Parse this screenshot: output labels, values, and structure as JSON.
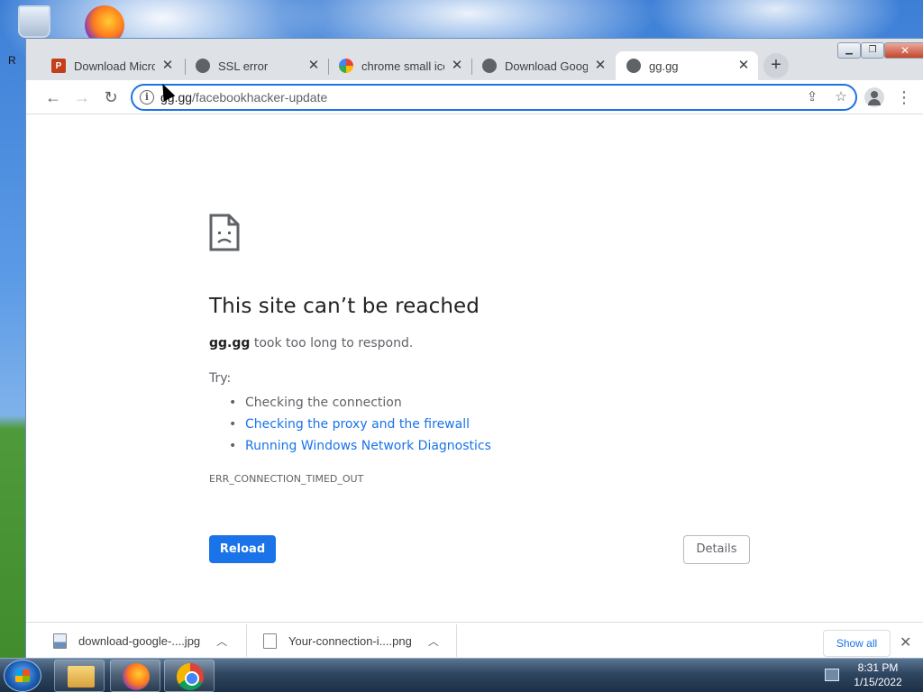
{
  "tabs": [
    {
      "title": "Download Microsoft",
      "favicon": "powerpoint-icon"
    },
    {
      "title": "SSL error",
      "favicon": "globe-icon"
    },
    {
      "title": "chrome small icon",
      "favicon": "google-icon"
    },
    {
      "title": "Download Google",
      "favicon": "globe-icon"
    },
    {
      "title": "gg.gg",
      "favicon": "globe-icon",
      "active": true
    }
  ],
  "omnibox": {
    "host": "gg.gg",
    "path": "/facebookhacker-update"
  },
  "error": {
    "title": "This site can’t be reached",
    "host": "gg.gg",
    "message": " took too long to respond.",
    "try_label": "Try:",
    "suggestions": [
      {
        "text": "Checking the connection",
        "link": false
      },
      {
        "text": "Checking the proxy and the firewall",
        "link": true
      },
      {
        "text": "Running Windows Network Diagnostics",
        "link": true
      }
    ],
    "code": "ERR_CONNECTION_TIMED_OUT",
    "reload_label": "Reload",
    "details_label": "Details"
  },
  "downloads": {
    "items": [
      {
        "name": "download-google-....jpg",
        "icon": "image-file-icon"
      },
      {
        "name": "Your-connection-i....png",
        "icon": "file-icon"
      }
    ],
    "show_all": "Show all"
  },
  "desktop": {
    "side_text": "R"
  },
  "taskbar": {
    "time": "8:31 PM",
    "date": "1/15/2022"
  },
  "colors": {
    "accent": "#1a73e8",
    "tabstrip": "#dee1e6",
    "text": "#202124",
    "muted": "#5f6368"
  }
}
